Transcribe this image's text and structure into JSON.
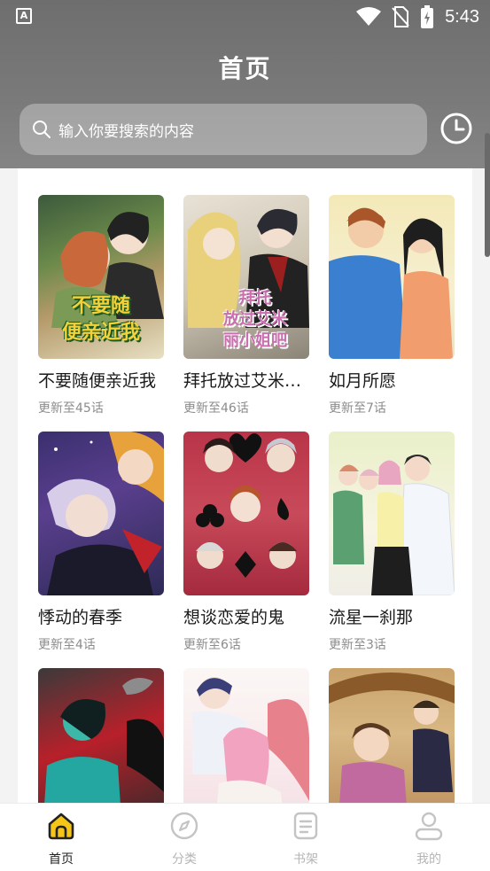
{
  "status_bar": {
    "time": "5:43",
    "left_icon": "A"
  },
  "header": {
    "title": "首页"
  },
  "search": {
    "placeholder": "输入你要搜索的内容"
  },
  "comics": [
    {
      "title": "不要随便亲近我",
      "update": "更新至45话",
      "cover_text": "不要随\n便亲近我"
    },
    {
      "title": "拜托放过艾米…",
      "update": "更新至46话",
      "cover_text": "拜托\n放过艾米\n丽小姐吧"
    },
    {
      "title": "如月所愿",
      "update": "更新至7话"
    },
    {
      "title": "悸动的春季",
      "update": "更新至4话"
    },
    {
      "title": "想谈恋爱的鬼",
      "update": "更新至6话"
    },
    {
      "title": "流星一刹那",
      "update": "更新至3话"
    },
    {
      "title": "",
      "update": ""
    },
    {
      "title": "",
      "update": ""
    },
    {
      "title": "",
      "update": ""
    }
  ],
  "bottom_nav": [
    {
      "label": "首页",
      "icon": "home-icon",
      "active": true
    },
    {
      "label": "分类",
      "icon": "compass-icon",
      "active": false
    },
    {
      "label": "书架",
      "icon": "bookshelf-icon",
      "active": false
    },
    {
      "label": "我的",
      "icon": "user-icon",
      "active": false
    }
  ],
  "colors": {
    "accent": "#f5c518",
    "header_bg": "#777777"
  }
}
